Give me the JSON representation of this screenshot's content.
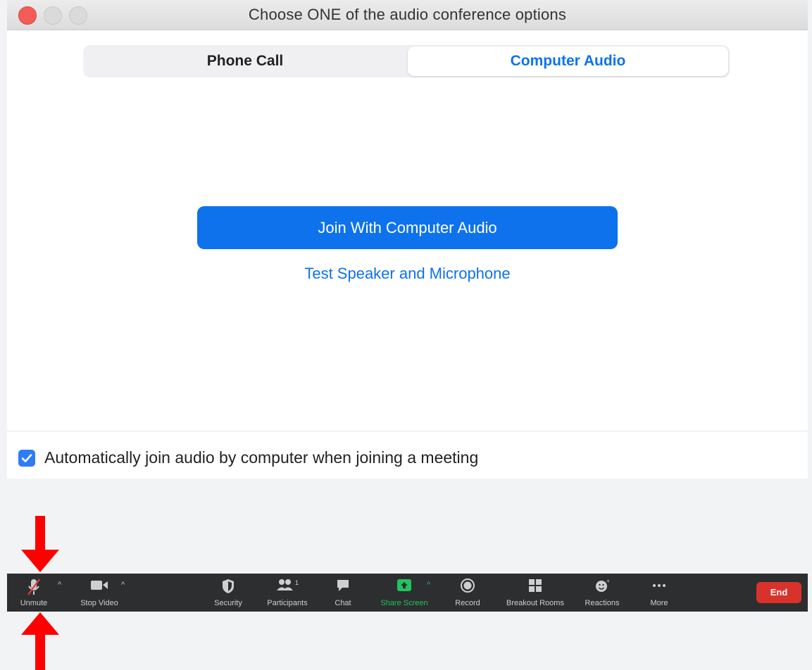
{
  "window": {
    "title": "Choose ONE of the audio conference options"
  },
  "tabs": [
    {
      "label": "Phone Call",
      "selected": false
    },
    {
      "label": "Computer Audio",
      "selected": true
    }
  ],
  "main": {
    "join_button": "Join With Computer Audio",
    "test_link": "Test Speaker and Microphone"
  },
  "auto_join": {
    "checked": true,
    "label": "Automatically join audio by computer when joining a meeting"
  },
  "toolbar": {
    "items": [
      {
        "label": "Unmute",
        "icon": "microphone-muted-icon"
      },
      {
        "label": "Stop Video",
        "icon": "video-camera-icon"
      },
      {
        "label": "Security",
        "icon": "shield-icon"
      },
      {
        "label": "Participants",
        "icon": "participants-icon",
        "count": "1"
      },
      {
        "label": "Chat",
        "icon": "chat-bubble-icon"
      },
      {
        "label": "Share Screen",
        "icon": "share-screen-icon"
      },
      {
        "label": "Record",
        "icon": "record-icon"
      },
      {
        "label": "Breakout Rooms",
        "icon": "breakout-rooms-icon"
      },
      {
        "label": "Reactions",
        "icon": "reactions-icon"
      },
      {
        "label": "More",
        "icon": "more-dots-icon"
      }
    ],
    "end_label": "End"
  },
  "colors": {
    "accent": "#0e72ed",
    "end": "#d9322b",
    "share_screen": "#22c35e",
    "annotation_arrow": "#ff0000"
  }
}
